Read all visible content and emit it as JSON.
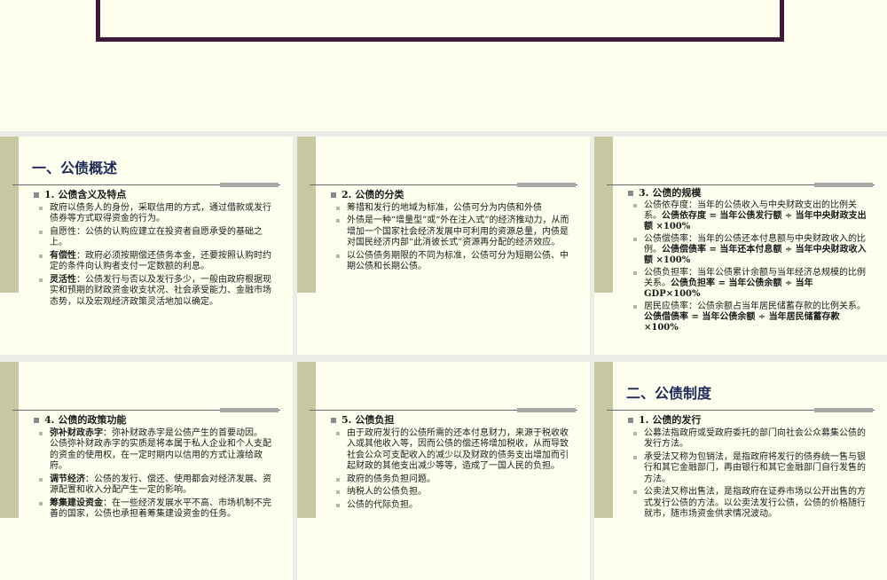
{
  "slides": [
    {
      "title": "一、公债概述",
      "heading": "1. 公债含义及特点",
      "items": [
        {
          "bold": "",
          "text": "政府以债务人的身份，采取信用的方式，通过借款或发行债券等方式取得资金的行为。"
        },
        {
          "bold": "",
          "text": "自愿性：公债的认购应建立在投资者自愿承受的基础之上。"
        },
        {
          "bold": "有偿性",
          "text": "：政府必须按期偿还债务本金，还要按照认购时约定的条件向认购者支付一定数额的利息。"
        },
        {
          "bold": "灵活性",
          "text": "：公债发行与否以及发行多少，一般由政府根据现实和预期的财政资金收支状况、社会承受能力、金融市场态势，以及宏观经济政策灵活地加以确定。"
        }
      ]
    },
    {
      "title": "",
      "heading": "2. 公债的分类",
      "items": [
        {
          "bold": "",
          "text": "筹措和发行的地域为标准，公债可分为内债和外债"
        },
        {
          "bold": "",
          "text": " 外债是一种“增量型”或“外在注入式”的经济推动力，从而增加一个国家社会经济发展中可利用的资源总量，内债是对国民经济内部“此消彼长式”资源再分配的经济效应。"
        },
        {
          "bold": "",
          "text": "以公债债务期限的不同为标准，公债可分为短期公债、中期公债和长期公债。"
        }
      ]
    },
    {
      "title": "",
      "heading": "3. 公债的规模",
      "items": [
        {
          "bold": "",
          "text": "公债依存度：当年的公债收入与中央财政支出的比例关系。",
          "bold2": "公债依存度 = 当年公债发行额 ÷ 当年中央财政支出额 ×100%"
        },
        {
          "bold": "",
          "text": "公债偿债率：当年的公债还本付息额与中央财政收入的比例。",
          "bold2": "公债偿债率 = 当年还本付息额 ÷ 当年中央财政收入额 ×100%"
        },
        {
          "bold": "",
          "text": "公债负担率：当年公债累计余额与当年经济总规模的比例关系。",
          "bold2": "公债负担率 = 当年公债余额 ÷ 当年GDP×100%"
        },
        {
          "bold": "",
          "text": "居民应债率：公债余额占当年居民储蓄存款的比例关系。",
          "bold2": "公债借债率 = 当年公债余额 ÷ 当年居民储蓄存款×100%"
        }
      ]
    },
    {
      "title": "",
      "heading": "4. 公债的政策功能",
      "items": [
        {
          "bold": "弥补财政赤字",
          "text": "：弥补财政赤字是公债产生的首要动因。 公债弥补财政赤字的实质是将本属于私人企业和个人支配的资金的使用权，在一定时期内以信用的方式让渡给政府。"
        },
        {
          "bold": "调节经济",
          "text": "：公债的发行、偿还、使用都会对经济发展、资源配置和收入分配产生一定的影响。"
        },
        {
          "bold": "筹集建设资金",
          "text": "：在一些经济发展水平不高、市场机制不完善的国家，公债也承担着筹集建设资金的任务。"
        }
      ]
    },
    {
      "title": "",
      "heading": "5. 公债负担",
      "items": [
        {
          "bold": "",
          "text": "由于政府发行的公债所需的还本付息财力，来源于税收收入或其他收入等，因而公债的偿还将增加税收，从而导致社会公众可支配收入的减少以及财政的债务支出增加而引起财政的其他支出减少等等，造成了一国人民的负担。"
        },
        {
          "bold": "",
          "text": "政府的债务负担问题。"
        },
        {
          "bold": "",
          "text": "纳税人的公债负担。"
        },
        {
          "bold": "",
          "text": "公债的代际负担。"
        }
      ]
    },
    {
      "title": "二、公债制度",
      "heading": "1. 公债的发行",
      "items": [
        {
          "bold": "",
          "text": "公募法指政府或受政府委托的部门向社会公众募集公债的发行方法。"
        },
        {
          "bold": "",
          "text": "承受法又称为包销法，是指政府将发行的债券统一售与银行和其它金融部门，再由银行和其它金融部门自行发售的方法。"
        },
        {
          "bold": "",
          "text": "公卖法又称出售法，是指政府在证券市场以公开出售的方式发行公债的方法。以公卖法发行公债，公债的价格随行就市，随市场资金供求情况波动。"
        }
      ]
    }
  ]
}
